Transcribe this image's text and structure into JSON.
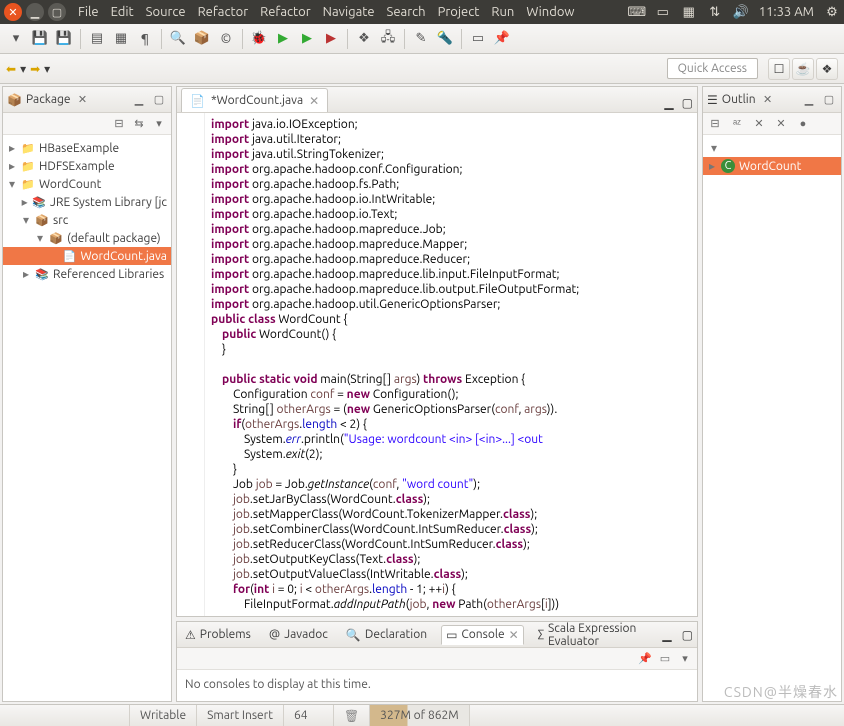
{
  "topbar": {
    "menus": [
      "File",
      "Edit",
      "Source",
      "Refactor",
      "Refactor",
      "Navigate",
      "Search",
      "Project",
      "Run",
      "Window"
    ],
    "time": "11:33 AM"
  },
  "toolbar2": {
    "quick_access": "Quick Access"
  },
  "package_view": {
    "title": "Package",
    "items": [
      {
        "name": "HBaseExample",
        "level": 0,
        "tw": "▸",
        "sel": false,
        "ico": "📁"
      },
      {
        "name": "HDFSExample",
        "level": 0,
        "tw": "▸",
        "sel": false,
        "ico": "📁"
      },
      {
        "name": "WordCount",
        "level": 0,
        "tw": "▾",
        "sel": false,
        "ico": "📁"
      },
      {
        "name": "JRE System Library [jc",
        "level": 1,
        "tw": "▸",
        "sel": false,
        "ico": "📚"
      },
      {
        "name": "src",
        "level": 1,
        "tw": "▾",
        "sel": false,
        "ico": "📦"
      },
      {
        "name": "(default package)",
        "level": 2,
        "tw": "▾",
        "sel": false,
        "ico": "📦"
      },
      {
        "name": "WordCount.java",
        "level": 3,
        "tw": "",
        "sel": true,
        "ico": "📄"
      },
      {
        "name": "Referenced Libraries",
        "level": 1,
        "tw": "▸",
        "sel": false,
        "ico": "📚"
      }
    ]
  },
  "editor": {
    "tab_label": "*WordCount.java",
    "lines": [
      [
        [
          "kw",
          "import"
        ],
        [
          "typ",
          " java.io.IOException;"
        ]
      ],
      [
        [
          "kw",
          "import"
        ],
        [
          "typ",
          " java.util.Iterator;"
        ]
      ],
      [
        [
          "kw",
          "import"
        ],
        [
          "typ",
          " java.util.StringTokenizer;"
        ]
      ],
      [
        [
          "kw",
          "import"
        ],
        [
          "typ",
          " org.apache.hadoop.conf.Configuration;"
        ]
      ],
      [
        [
          "kw",
          "import"
        ],
        [
          "typ",
          " org.apache.hadoop.fs.Path;"
        ]
      ],
      [
        [
          "kw",
          "import"
        ],
        [
          "typ",
          " org.apache.hadoop.io.IntWritable;"
        ]
      ],
      [
        [
          "kw",
          "import"
        ],
        [
          "typ",
          " org.apache.hadoop.io.Text;"
        ]
      ],
      [
        [
          "kw",
          "import"
        ],
        [
          "typ",
          " org.apache.hadoop.mapreduce.Job;"
        ]
      ],
      [
        [
          "kw",
          "import"
        ],
        [
          "typ",
          " org.apache.hadoop.mapreduce.Mapper;"
        ]
      ],
      [
        [
          "kw",
          "import"
        ],
        [
          "typ",
          " org.apache.hadoop.mapreduce.Reducer;"
        ]
      ],
      [
        [
          "kw",
          "import"
        ],
        [
          "typ",
          " org.apache.hadoop.mapreduce.lib.input.FileInputFormat;"
        ]
      ],
      [
        [
          "kw",
          "import"
        ],
        [
          "typ",
          " org.apache.hadoop.mapreduce.lib.output.FileOutputFormat;"
        ]
      ],
      [
        [
          "kw",
          "import"
        ],
        [
          "typ",
          " org.apache.hadoop.util.GenericOptionsParser;"
        ]
      ],
      [
        [
          "kw",
          "public class"
        ],
        [
          "typ",
          " WordCount {"
        ]
      ],
      [
        [
          "typ",
          "    "
        ],
        [
          "kw",
          "public"
        ],
        [
          "typ",
          " WordCount() {"
        ]
      ],
      [
        [
          "typ",
          "    }"
        ]
      ],
      [
        [
          "typ",
          ""
        ]
      ],
      [
        [
          "typ",
          "    "
        ],
        [
          "kw",
          "public static void"
        ],
        [
          "typ",
          " main(String[] "
        ],
        [
          "mut",
          "args"
        ],
        [
          "typ",
          ") "
        ],
        [
          "kw",
          "throws"
        ],
        [
          "typ",
          " Exception {"
        ]
      ],
      [
        [
          "typ",
          "        Configuration "
        ],
        [
          "mut",
          "conf"
        ],
        [
          "typ",
          " = "
        ],
        [
          "kw",
          "new"
        ],
        [
          "typ",
          " Configuration();"
        ]
      ],
      [
        [
          "typ",
          "        String[] "
        ],
        [
          "mut",
          "otherArgs"
        ],
        [
          "typ",
          " = ("
        ],
        [
          "kw",
          "new"
        ],
        [
          "typ",
          " GenericOptionsParser("
        ],
        [
          "mut",
          "conf"
        ],
        [
          "typ",
          ", "
        ],
        [
          "mut",
          "args"
        ],
        [
          "typ",
          "))."
        ]
      ],
      [
        [
          "typ",
          "        "
        ],
        [
          "kw",
          "if"
        ],
        [
          "typ",
          "("
        ],
        [
          "mut",
          "otherArgs"
        ],
        [
          "typ",
          "."
        ],
        [
          "fld",
          "length"
        ],
        [
          "typ",
          " < 2) {"
        ]
      ],
      [
        [
          "typ",
          "            System."
        ],
        [
          "fld it",
          "err"
        ],
        [
          "typ",
          ".println("
        ],
        [
          "str",
          "\"Usage: wordcount <in> [<in>...] <out"
        ]
      ],
      [
        [
          "typ",
          "            System."
        ],
        [
          "it",
          "exit"
        ],
        [
          "typ",
          "(2);"
        ]
      ],
      [
        [
          "typ",
          "        }"
        ]
      ],
      [
        [
          "typ",
          "        Job "
        ],
        [
          "mut",
          "job"
        ],
        [
          "typ",
          " = Job."
        ],
        [
          "it",
          "getInstance"
        ],
        [
          "typ",
          "("
        ],
        [
          "mut",
          "conf"
        ],
        [
          "typ",
          ", "
        ],
        [
          "str",
          "\"word count\""
        ],
        [
          "typ",
          ");"
        ]
      ],
      [
        [
          "typ",
          "        "
        ],
        [
          "mut",
          "job"
        ],
        [
          "typ",
          ".setJarByClass(WordCount."
        ],
        [
          "kw",
          "class"
        ],
        [
          "typ",
          ");"
        ]
      ],
      [
        [
          "typ",
          "        "
        ],
        [
          "mut",
          "job"
        ],
        [
          "typ",
          ".setMapperClass(WordCount.TokenizerMapper."
        ],
        [
          "kw",
          "class"
        ],
        [
          "typ",
          ");"
        ]
      ],
      [
        [
          "typ",
          "        "
        ],
        [
          "mut",
          "job"
        ],
        [
          "typ",
          ".setCombinerClass(WordCount.IntSumReducer."
        ],
        [
          "kw",
          "class"
        ],
        [
          "typ",
          ");"
        ]
      ],
      [
        [
          "typ",
          "        "
        ],
        [
          "mut",
          "job"
        ],
        [
          "typ",
          ".setReducerClass(WordCount.IntSumReducer."
        ],
        [
          "kw",
          "class"
        ],
        [
          "typ",
          ");"
        ]
      ],
      [
        [
          "typ",
          "        "
        ],
        [
          "mut",
          "job"
        ],
        [
          "typ",
          ".setOutputKeyClass(Text."
        ],
        [
          "kw",
          "class"
        ],
        [
          "typ",
          ");"
        ]
      ],
      [
        [
          "typ",
          "        "
        ],
        [
          "mut",
          "job"
        ],
        [
          "typ",
          ".setOutputValueClass(IntWritable."
        ],
        [
          "kw",
          "class"
        ],
        [
          "typ",
          ");"
        ]
      ],
      [
        [
          "typ",
          "        "
        ],
        [
          "kw",
          "for"
        ],
        [
          "typ",
          "("
        ],
        [
          "kw",
          "int"
        ],
        [
          "typ",
          " "
        ],
        [
          "mut",
          "i"
        ],
        [
          "typ",
          " = 0; "
        ],
        [
          "mut",
          "i"
        ],
        [
          "typ",
          " < "
        ],
        [
          "mut",
          "otherArgs"
        ],
        [
          "typ",
          "."
        ],
        [
          "fld",
          "length"
        ],
        [
          "typ",
          " - 1; ++"
        ],
        [
          "mut",
          "i"
        ],
        [
          "typ",
          ") {"
        ]
      ],
      [
        [
          "typ",
          "            FileInputFormat."
        ],
        [
          "it",
          "addInputPath"
        ],
        [
          "typ",
          "("
        ],
        [
          "mut",
          "job"
        ],
        [
          "typ",
          ", "
        ],
        [
          "kw",
          "new"
        ],
        [
          "typ",
          " Path("
        ],
        [
          "mut",
          "otherArgs"
        ],
        [
          "typ",
          "["
        ],
        [
          "mut",
          "i"
        ],
        [
          "typ",
          "]))"
        ]
      ]
    ]
  },
  "outline": {
    "title": "Outlin",
    "root": "WordCount"
  },
  "bottom": {
    "tabs": [
      "Problems",
      "Javadoc",
      "Declaration",
      "Console",
      "Scala Expression Evaluator"
    ],
    "active": 3,
    "message": "No consoles to display at this time."
  },
  "status": {
    "writable": "Writable",
    "mode": "Smart Insert",
    "pos": "64",
    "heap": "327M of 862M"
  },
  "watermark": "CSDN@半燥春水"
}
